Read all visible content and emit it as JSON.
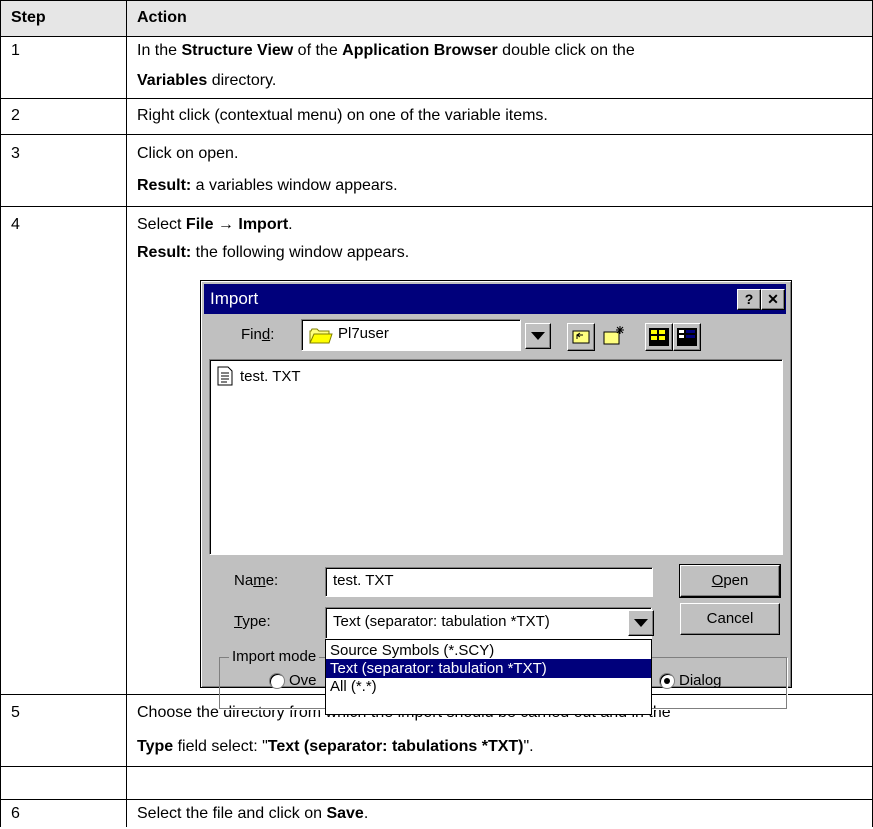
{
  "table": {
    "headers": {
      "step": "Step",
      "action": "Action"
    },
    "rows": [
      {
        "step": "1",
        "line1": [
          {
            "t": "In the ",
            "b": false
          },
          {
            "t": "Structure View",
            "b": true
          },
          {
            "t": " of the ",
            "b": false
          },
          {
            "t": "Application Browser",
            "b": true
          },
          {
            "t": " double click on the",
            "b": false
          }
        ],
        "line2": [
          {
            "t": "Variables",
            "b": true
          },
          {
            "t": " directory.",
            "b": false
          }
        ]
      },
      {
        "step": "2",
        "text": "Right click (contextual menu) on one of the variable items."
      },
      {
        "step": "3",
        "text": "Click on open.",
        "result_label": "Result:",
        "result_text": " a variables window appears."
      },
      {
        "step": "4",
        "line1": [
          {
            "t": "Select ",
            "b": false
          },
          {
            "t": "File",
            "b": true
          },
          {
            "t": " → ",
            "b": false
          },
          {
            "t": "Import",
            "b": true
          },
          {
            "t": ".",
            "b": false
          }
        ],
        "result_label": "Result:",
        "result_text": " the following window appears."
      },
      {
        "step": "5",
        "line1": "Choose the directory from which the import should be carried out and in the",
        "line2": [
          {
            "t": "Type",
            "b": true
          },
          {
            "t": " field select: \"",
            "b": false
          },
          {
            "t": "Text (separator: tabulations *TXT)",
            "b": true
          },
          {
            "t": "\".",
            "b": false
          }
        ]
      },
      {
        "step": "6",
        "line1": [
          {
            "t": "Select the file and click on ",
            "b": false
          },
          {
            "t": "Save",
            "b": true
          },
          {
            "t": ".",
            "b": false
          }
        ]
      }
    ]
  },
  "dialog": {
    "title": "Import",
    "help_btn": "?",
    "close_btn": "✕",
    "find_label": {
      "pre": "Fin",
      "ul": "d",
      "post": ":"
    },
    "find_value": "Pl7user",
    "file_item": "test. TXT",
    "name_label": {
      "pre": "Na",
      "ul": "m",
      "post": "e:"
    },
    "name_value": "test. TXT",
    "type_label": {
      "ul": "T",
      "post": "ype:"
    },
    "type_value": "Text (separator: tabulation *TXT)",
    "open_btn": {
      "ul": "O",
      "post": "pen"
    },
    "cancel_btn": "Cancel",
    "import_mode_label": "Import mode",
    "overwrite_partial": "Ove",
    "dialog_radio": "Dialog",
    "type_options": [
      "Source Symbols (*.SCY)",
      "Text (separator: tabulation *TXT)",
      "All (*.*)"
    ],
    "selected_option_index": 1,
    "icons": {
      "find_folder": "folder-icon",
      "up_folder": "up-folder-icon",
      "new_folder": "new-folder-icon",
      "list_view": "list-view-icon",
      "details_view": "details-view-icon",
      "file": "text-file-icon"
    }
  }
}
